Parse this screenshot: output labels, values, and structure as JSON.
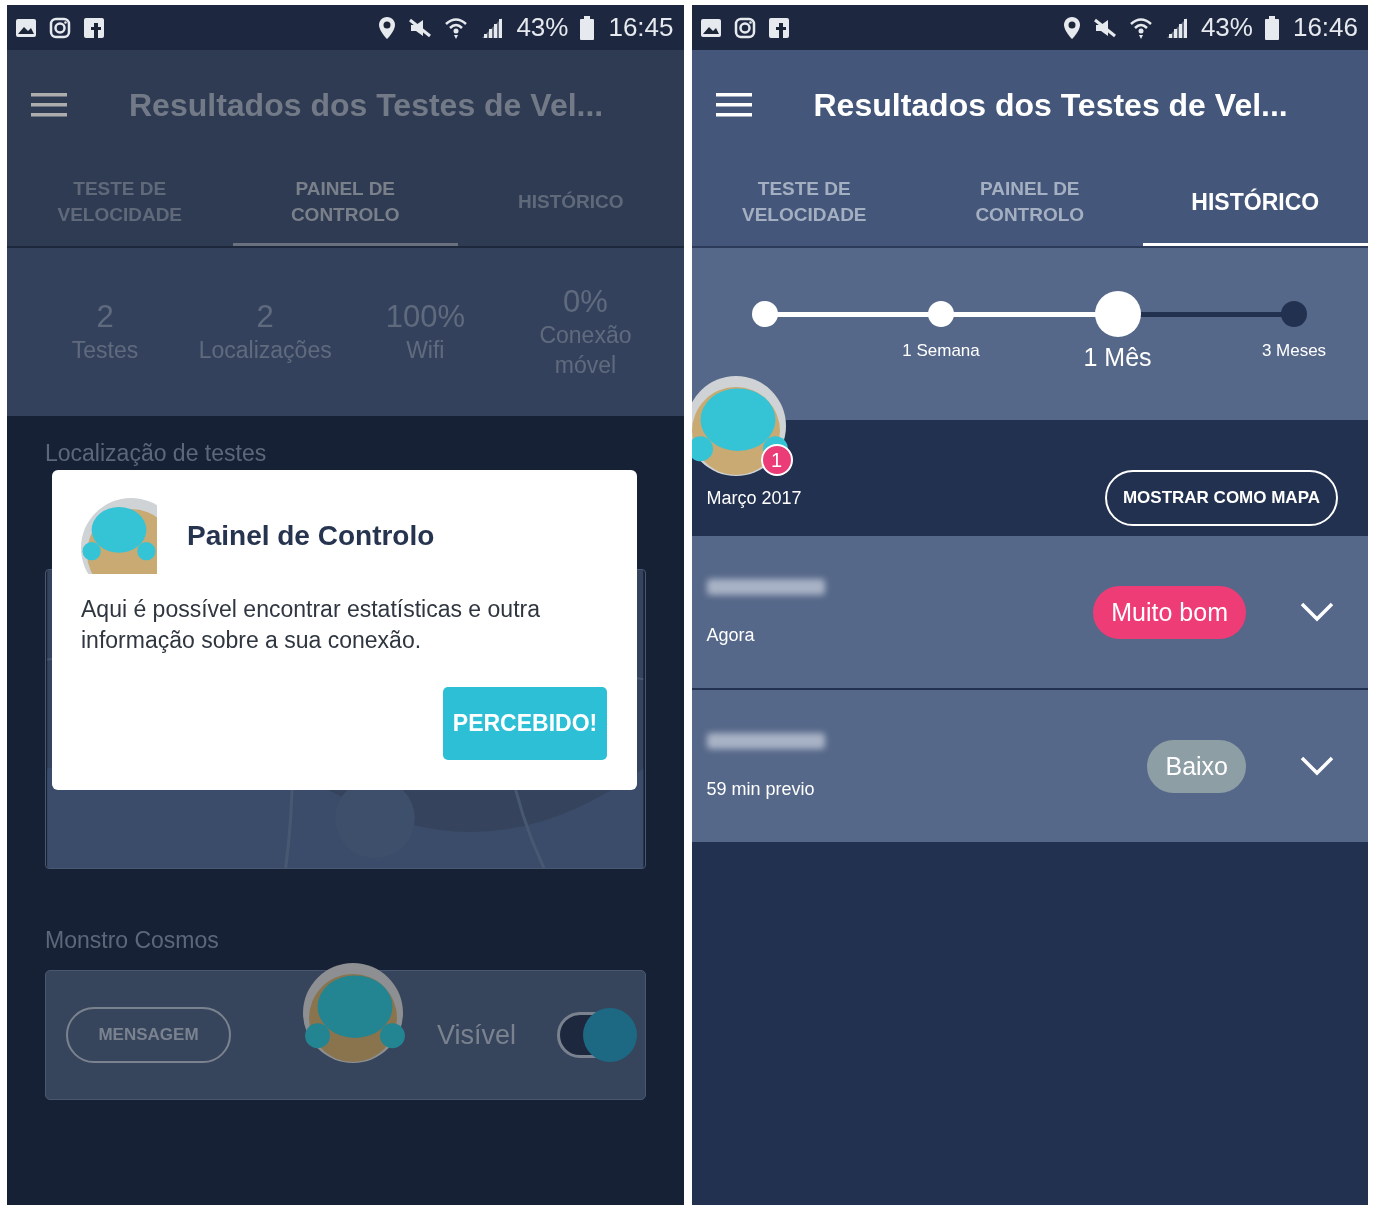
{
  "screens": [
    {
      "dimmed": true,
      "status_bar": {
        "battery": "43%",
        "time": "16:45"
      },
      "app_bar": {
        "title": "Resultados dos Testes de Vel..."
      },
      "tabs": [
        {
          "label": "TESTE DE VELOCIDADE",
          "selected": false
        },
        {
          "label": "PAINEL DE CONTROLO",
          "selected": true
        },
        {
          "label": "HISTÓRICO",
          "selected": false
        }
      ],
      "content": {
        "kind": "dashboard",
        "stats": [
          {
            "value": "2",
            "label": "Testes"
          },
          {
            "value": "2",
            "label": "Localizações"
          },
          {
            "value": "100%",
            "label": "Wifi"
          },
          {
            "value": "0%",
            "label": "Conexão móvel"
          }
        ],
        "sections": [
          {
            "kind": "map",
            "title": "Localização de testes"
          },
          {
            "kind": "monster",
            "title": "Monstro Cosmos",
            "button": "MENSAGEM",
            "toggle_label": "Visível",
            "toggle_on": true
          }
        ]
      },
      "dialog": {
        "title": "Painel de Controlo",
        "text": "Aqui é possível encontrar estatísticas e outra informação sobre a sua conexão.",
        "button": "PERCEBIDO!"
      }
    },
    {
      "dimmed": false,
      "status_bar": {
        "battery": "43%",
        "time": "16:46"
      },
      "app_bar": {
        "title": "Resultados dos Testes de Vel..."
      },
      "tabs": [
        {
          "label": "TESTE DE VELOCIDADE",
          "selected": false
        },
        {
          "label": "PAINEL DE CONTROLO",
          "selected": false
        },
        {
          "label": "HISTÓRICO",
          "selected": true
        }
      ],
      "content": {
        "kind": "history",
        "range": {
          "level": 0.667,
          "options": [
            {
              "selected": false
            },
            {
              "label": "1 Semana",
              "selected": false
            },
            {
              "label": "1 Mês",
              "selected": true
            },
            {
              "label": "3 Meses",
              "selected": false
            }
          ]
        },
        "badge": "1",
        "month": "Março 2017",
        "map_button": "MOSTRAR COMO MAPA",
        "results": [
          {
            "time": "Agora",
            "rating": "Muito bom",
            "color": "#ee3c76"
          },
          {
            "time": "59 min previo",
            "rating": "Baixo",
            "color": "#8d9ea5"
          }
        ]
      }
    }
  ]
}
